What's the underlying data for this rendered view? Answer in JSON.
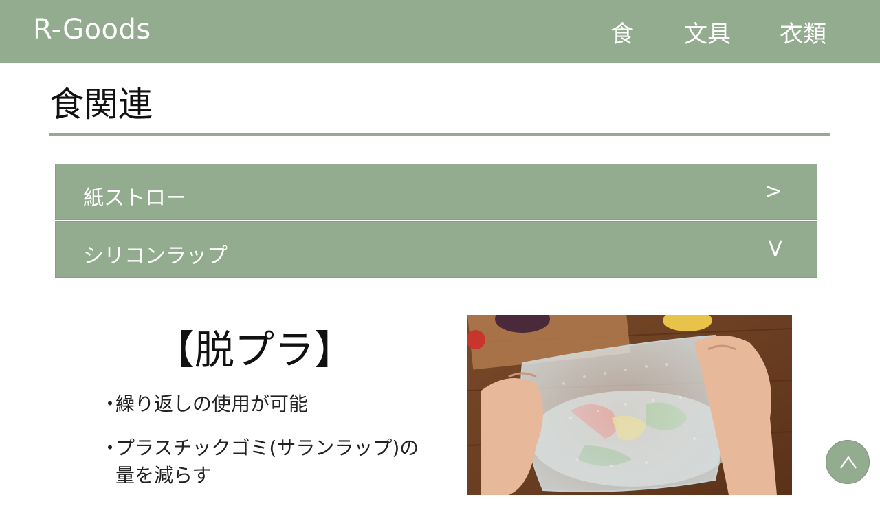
{
  "header": {
    "logo": "R-Goods",
    "nav": [
      "食",
      "文具",
      "衣類"
    ]
  },
  "page": {
    "title": "食関連"
  },
  "accordion": [
    {
      "label": "紙ストロー",
      "chevron": ">"
    },
    {
      "label": "シリコンラップ",
      "chevron": "V"
    }
  ],
  "product": {
    "heading": "【脱プラ】",
    "bullets": [
      "繰り返しの使用が可能",
      "プラスチックゴミ(サランラップ)の量を減らす"
    ],
    "bullet_marker": "・"
  },
  "colors": {
    "accent": "#93ab8f",
    "text_on_accent": "#ffffff"
  },
  "icons": {
    "back_to_top": "chevron-up-icon"
  }
}
